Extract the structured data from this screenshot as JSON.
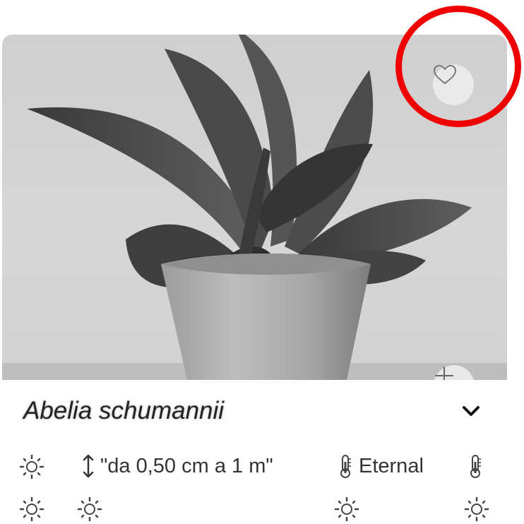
{
  "plant": {
    "name": "Abelia schumannii"
  },
  "actions": {
    "favorite_icon": "heart-outline-icon",
    "add_icon": "plus-icon",
    "expand_icon": "chevron-down-icon"
  },
  "attributes": {
    "height": "\"da 0,50 cm a 1 m\"",
    "temperature": "Eternal"
  },
  "annotation": {
    "highlight_color": "#f00000"
  }
}
